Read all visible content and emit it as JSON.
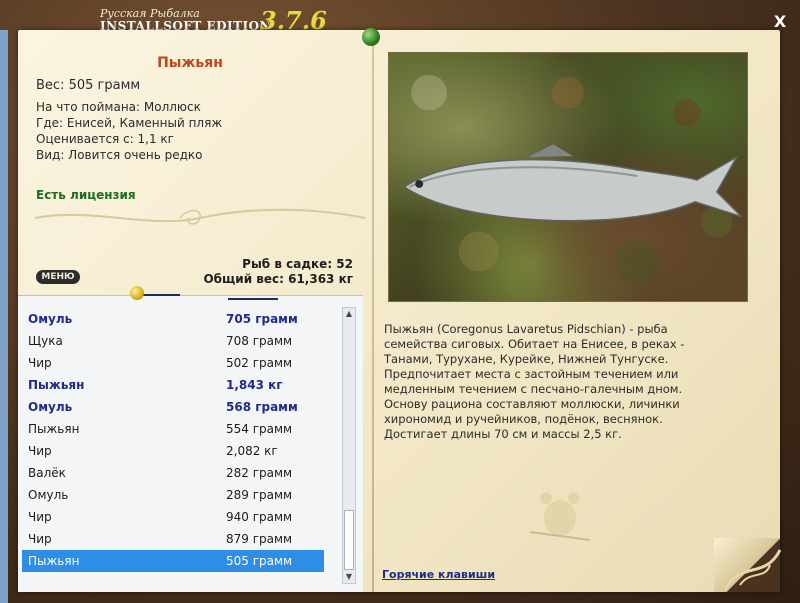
{
  "window": {
    "brand": "Русская Рыбалка",
    "edition": "INSTALLSOFT EDITION",
    "version": "3.7.6",
    "close_label": "X"
  },
  "fish_card": {
    "title": "Пыжьян",
    "weight_line": "Вес: 505 грамм",
    "bait_line": "На что поймана: Моллюск",
    "location_line": "Где: Енисей, Каменный пляж",
    "rated_line": "Оценивается с: 1,1 кг",
    "kind_line": "Вид: Ловится очень редко",
    "license": "Есть лицензия"
  },
  "stats": {
    "fish_count_line": "Рыб в садке: 52",
    "total_weight_line": "Общий вес: 61,363 кг"
  },
  "menu_label": "МЕНЮ",
  "catch_list": [
    {
      "name": "Омуль",
      "weight": "705 грамм",
      "bold": true,
      "selected": false
    },
    {
      "name": "Щука",
      "weight": "708 грамм",
      "bold": false,
      "selected": false
    },
    {
      "name": "Чир",
      "weight": "502 грамм",
      "bold": false,
      "selected": false
    },
    {
      "name": "Пыжьян",
      "weight": "1,843 кг",
      "bold": true,
      "selected": false
    },
    {
      "name": "Омуль",
      "weight": "568 грамм",
      "bold": true,
      "selected": false
    },
    {
      "name": "Пыжьян",
      "weight": "554 грамм",
      "bold": false,
      "selected": false
    },
    {
      "name": "Чир",
      "weight": "2,082 кг",
      "bold": false,
      "selected": false
    },
    {
      "name": "Валёк",
      "weight": "282 грамм",
      "bold": false,
      "selected": false
    },
    {
      "name": "Омуль",
      "weight": "289 грамм",
      "bold": false,
      "selected": false
    },
    {
      "name": "Чир",
      "weight": "940 грамм",
      "bold": false,
      "selected": false
    },
    {
      "name": "Чир",
      "weight": "879 грамм",
      "bold": false,
      "selected": false
    },
    {
      "name": "Пыжьян",
      "weight": "505 грамм",
      "bold": false,
      "selected": true
    }
  ],
  "description": "Пыжьян (Coregonus Lavaretus Pidschian) - рыба семейства сиговых. Обитает на Енисее, в реках - Танами, Турухане, Курейке, Нижней Тунгуске. Предпочитает места с застойным течением или медленным течением с песчано-галечным дном. Основу рациона составляют моллюски, личинки хирономид и ручейников, подёнок, веснянок. Достигает длины 70 см и массы 2,5 кг.",
  "hotkeys_link": "Горячие клавиши",
  "colors": {
    "title_red": "#c0461c",
    "license_green": "#1f6e1f",
    "bold_blue": "#1f2c8a",
    "selection_blue": "#2e8ee6",
    "version_yellow": "#e7d84a"
  },
  "icons": {
    "close": "close-icon",
    "pin": "pushpin-icon",
    "logo": "fishing-logo-icon",
    "scroll_up": "scroll-up-arrow-icon",
    "scroll_down": "scroll-down-arrow-icon"
  }
}
